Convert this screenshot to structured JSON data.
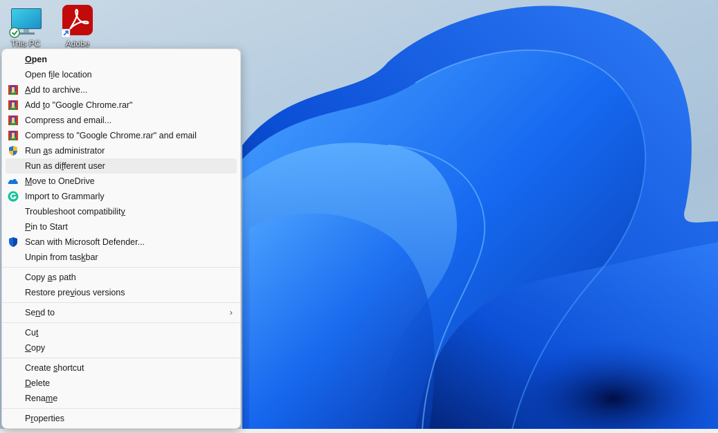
{
  "desktop": {
    "icons": [
      {
        "label": "This PC",
        "icon": "computer-monitor-icon",
        "badge": "sync-check-badge"
      },
      {
        "label": "Adobe",
        "icon": "adobe-acrobat-icon",
        "badge": "shortcut-arrow-badge"
      }
    ],
    "wallpaper": "windows-11-bloom-blue"
  },
  "context_menu": {
    "groups": [
      [
        {
          "label": "Open",
          "mnemonic": "O",
          "bold": true,
          "icon": null
        },
        {
          "label": "Open file location",
          "mnemonic": "i",
          "icon": null
        },
        {
          "label": "Add to archive...",
          "mnemonic": "A",
          "icon": "winrar-icon"
        },
        {
          "label": "Add to \"Google Chrome.rar\"",
          "mnemonic": "t",
          "icon": "winrar-icon"
        },
        {
          "label": "Compress and email...",
          "icon": "winrar-icon"
        },
        {
          "label": "Compress to \"Google Chrome.rar\" and email",
          "icon": "winrar-icon"
        },
        {
          "label": "Run as administrator",
          "mnemonic": "a",
          "icon": "uac-shield-icon"
        },
        {
          "label": "Run as different user",
          "mnemonic": "f",
          "icon": null,
          "hovered": true
        },
        {
          "label": "Move to OneDrive",
          "mnemonic": "M",
          "icon": "onedrive-cloud-icon"
        },
        {
          "label": "Import to Grammarly",
          "icon": "grammarly-icon"
        },
        {
          "label": "Troubleshoot compatibility",
          "mnemonic": "y",
          "icon": null
        },
        {
          "label": "Pin to Start",
          "mnemonic": "P",
          "icon": null
        },
        {
          "label": "Scan with Microsoft Defender...",
          "icon": "defender-shield-icon"
        },
        {
          "label": "Unpin from taskbar",
          "mnemonic": "k",
          "icon": null
        }
      ],
      [
        {
          "label": "Copy as path",
          "mnemonic": "a",
          "icon": null
        },
        {
          "label": "Restore previous versions",
          "mnemonic": "v",
          "icon": null
        }
      ],
      [
        {
          "label": "Send to",
          "mnemonic": "n",
          "icon": null,
          "submenu": true
        }
      ],
      [
        {
          "label": "Cut",
          "mnemonic": "t",
          "icon": null
        },
        {
          "label": "Copy",
          "mnemonic": "C",
          "icon": null
        }
      ],
      [
        {
          "label": "Create shortcut",
          "mnemonic": "s",
          "icon": null
        },
        {
          "label": "Delete",
          "mnemonic": "D",
          "icon": null
        },
        {
          "label": "Rename",
          "mnemonic": "m",
          "icon": null
        }
      ],
      [
        {
          "label": "Properties",
          "mnemonic": "r",
          "icon": null
        }
      ]
    ],
    "colors": {
      "background": "#f9f9f9",
      "hover": "#ececec",
      "separator": "#e3e3e3",
      "text": "#1a1a1a"
    }
  }
}
